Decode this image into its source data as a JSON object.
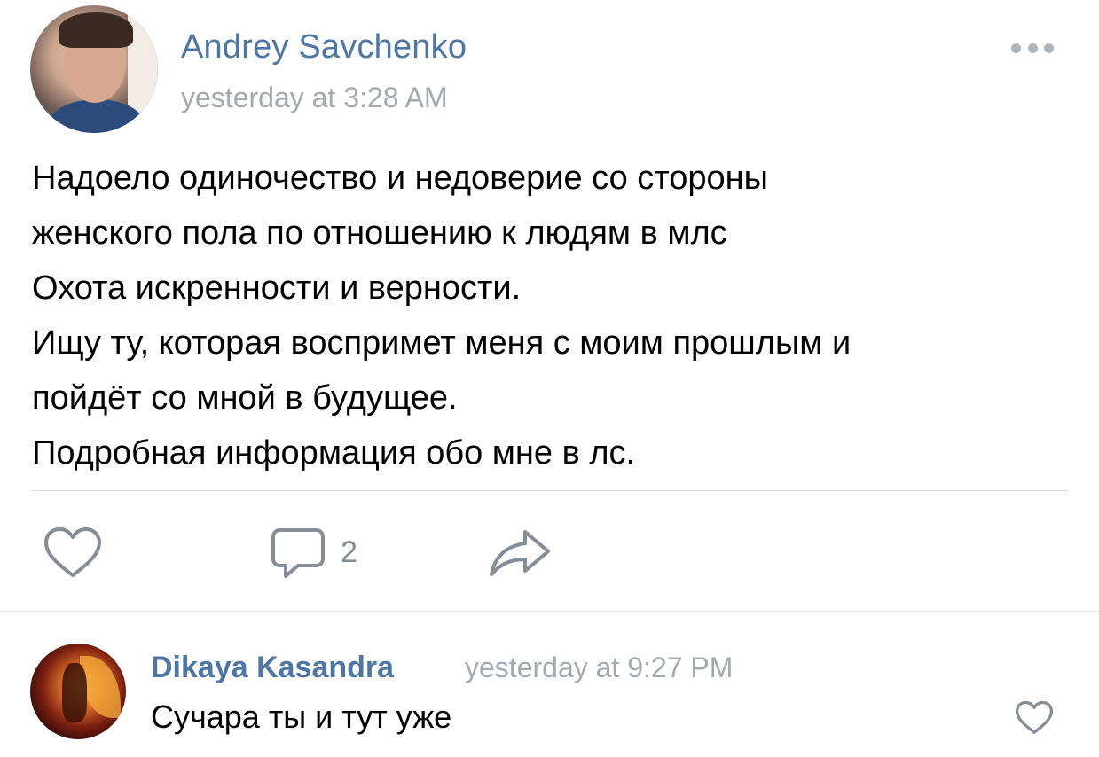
{
  "post": {
    "author_name": "Andrey Savchenko",
    "time": "yesterday at 3:28 AM",
    "lines": [
      "Надоело одиночество и недоверие со стороны",
      "женского пола по отношению к людям в млс",
      "Охота искренности и верности.",
      "Ищу ту, которая воспримет меня с моим прошлым и",
      "пойдёт со мной в будущее.",
      "Подробная информация обо мне в лс."
    ],
    "actions": {
      "like_icon": "heart-icon",
      "comment_icon": "comment-bubble-icon",
      "comment_count": "2",
      "share_icon": "share-arrow-icon"
    },
    "more_icon": "more-dots-icon"
  },
  "comment": {
    "author_name": "Dikaya Kasandra",
    "time": "yesterday at 9:27 PM",
    "text": "Сучара ты и тут уже",
    "like_icon": "heart-icon"
  },
  "colors": {
    "link_blue": "#4d76a5",
    "meta_gray": "#a4a9b0",
    "icon_gray": "#878d96",
    "divider": "#dcdfe3"
  }
}
